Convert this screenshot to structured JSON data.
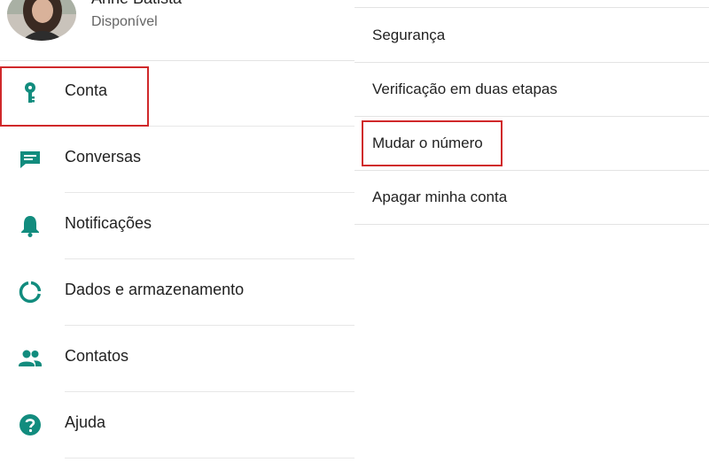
{
  "profile": {
    "name": "Anne Batista",
    "status": "Disponível"
  },
  "settings_menu": [
    {
      "label": "Conta",
      "icon": "key-icon"
    },
    {
      "label": "Conversas",
      "icon": "chat-icon"
    },
    {
      "label": "Notificações",
      "icon": "bell-icon"
    },
    {
      "label": "Dados e armazenamento",
      "icon": "data-usage-icon"
    },
    {
      "label": "Contatos",
      "icon": "contacts-icon"
    },
    {
      "label": "Ajuda",
      "icon": "help-icon"
    }
  ],
  "account_options": [
    {
      "label": "Segurança"
    },
    {
      "label": "Verificação em duas etapas"
    },
    {
      "label": "Mudar o número"
    },
    {
      "label": "Apagar minha conta"
    }
  ],
  "colors": {
    "icon_teal": "#128C7E",
    "highlight_red": "#d0282a"
  }
}
